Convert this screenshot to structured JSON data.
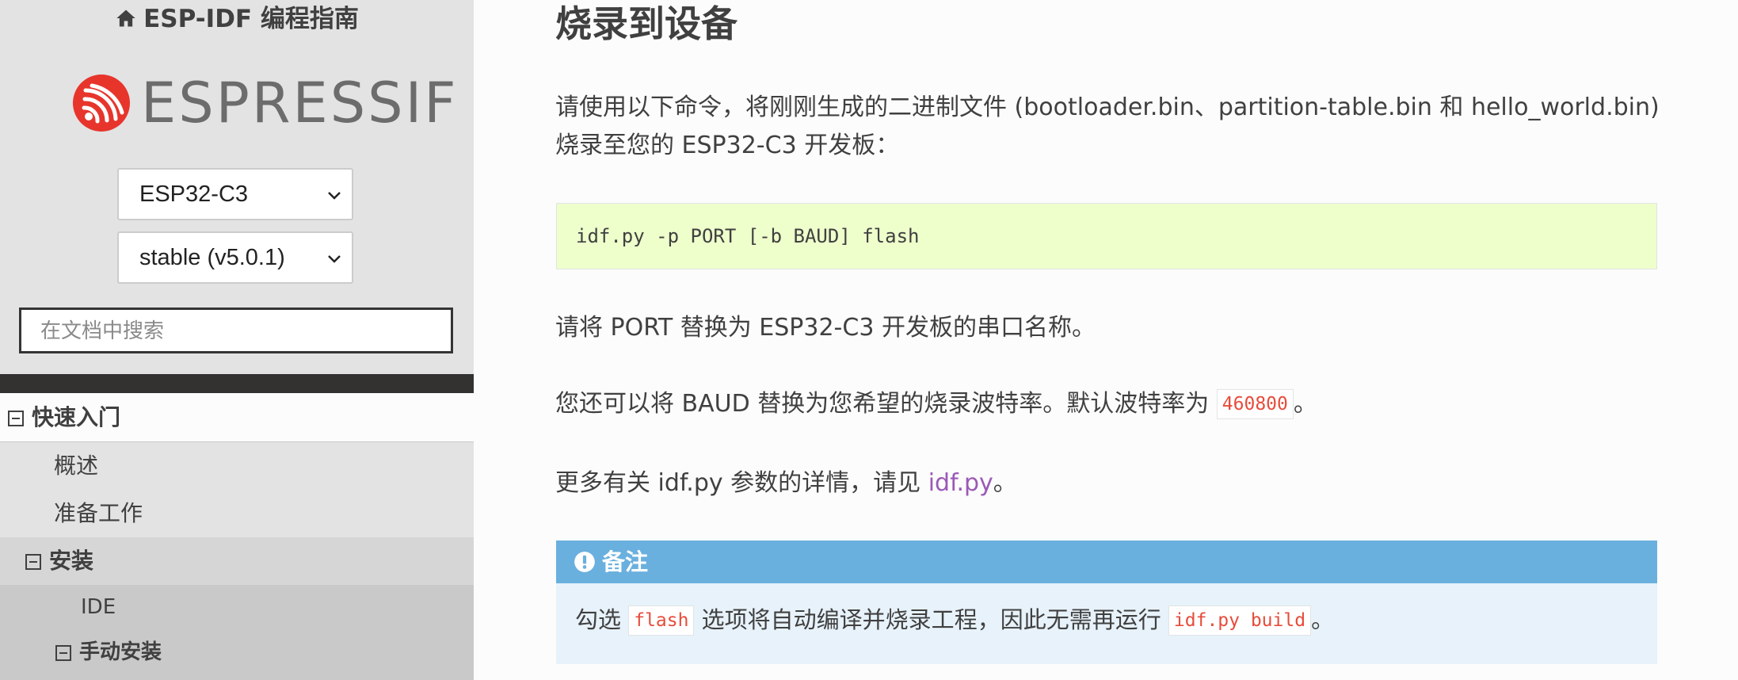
{
  "sidebar": {
    "project_title": "ESP-IDF 编程指南",
    "logo_text": "ESPRESSIF",
    "target_select": "ESP32-C3",
    "version_select": "stable (v5.0.1)",
    "search_placeholder": "在文档中搜索",
    "nav": [
      {
        "label": "快速入门"
      },
      {
        "label": "概述"
      },
      {
        "label": "准备工作"
      },
      {
        "label": "安装"
      },
      {
        "label": "IDE"
      },
      {
        "label": "手动安装"
      }
    ]
  },
  "main": {
    "title": "烧录到设备",
    "para1_line1": "请使用以下命令，将刚刚生成的二进制文件 (bootloader.bin、partition-table.bin 和 hello_world.bin)",
    "para1_line2": "烧录至您的 ESP32-C3 开发板：",
    "code": "idf.py -p PORT [-b BAUD] flash",
    "para2": "请将 PORT 替换为 ESP32-C3 开发板的串口名称。",
    "para3_before": "您还可以将 BAUD 替换为您希望的烧录波特率。默认波特率为 ",
    "para3_code": "460800",
    "para3_after": "。",
    "para4_before": "更多有关 idf.py 参数的详情，请见 ",
    "para4_link": "idf.py",
    "para4_after": "。",
    "note": {
      "title": "备注",
      "body_before": "勾选 ",
      "body_code1": "flash",
      "body_middle": " 选项将自动编译并烧录工程，因此无需再运行 ",
      "body_code2": "idf.py build",
      "body_after": "。"
    }
  },
  "colors": {
    "sidebar_bg": "#e3e3e3",
    "nav_active_bg": "#c9c9c9",
    "code_bg": "#eeffcc",
    "note_header": "#6ab0de",
    "note_bg": "#e7f2fa",
    "link": "#9b59b6",
    "inline_code": "#e74c3c",
    "logo_red": "#e7352c"
  }
}
